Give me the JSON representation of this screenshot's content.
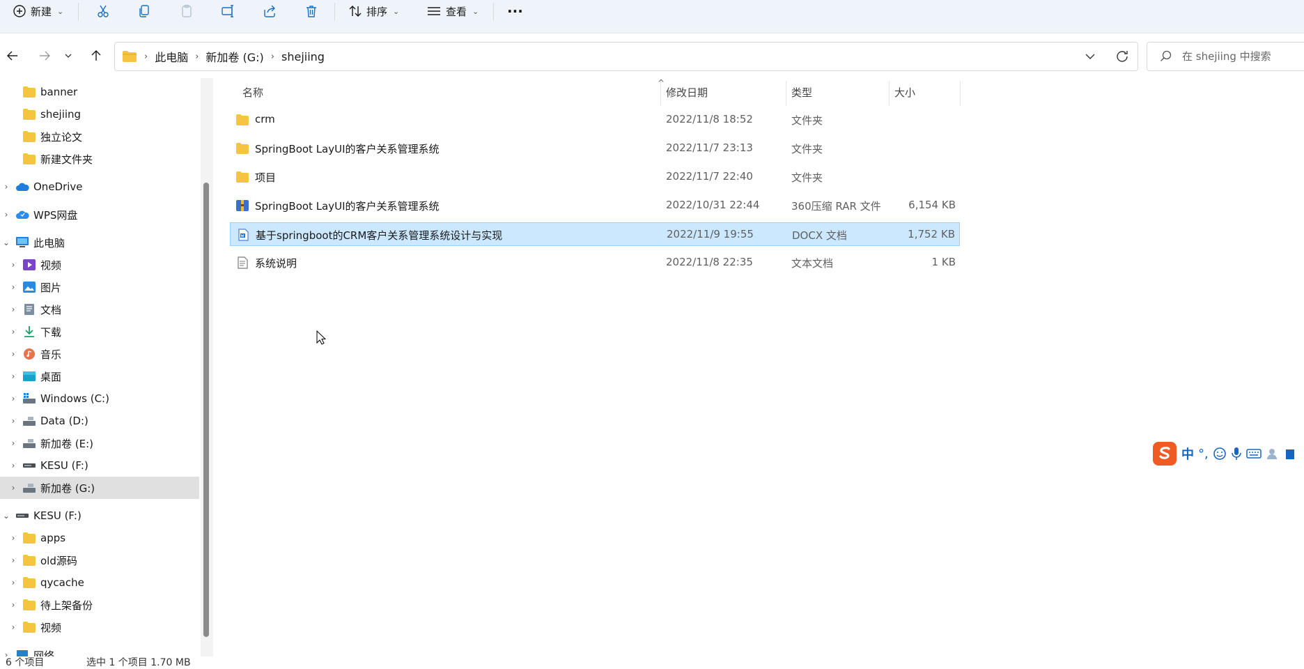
{
  "toolbar": {
    "new_label": "新建",
    "sort_label": "排序",
    "view_label": "查看",
    "more_label": "···"
  },
  "breadcrumb": {
    "items": [
      "此电脑",
      "新加卷 (G:)",
      "shejiing"
    ]
  },
  "search": {
    "placeholder": "在 shejiing 中搜索"
  },
  "sidebar": {
    "items": [
      {
        "label": "banner"
      },
      {
        "label": "shejiing"
      },
      {
        "label": "独立论文"
      },
      {
        "label": "新建文件夹"
      },
      {
        "label": "OneDrive"
      },
      {
        "label": "WPS网盘"
      },
      {
        "label": "此电脑"
      },
      {
        "label": "视频"
      },
      {
        "label": "图片"
      },
      {
        "label": "文档"
      },
      {
        "label": "下载"
      },
      {
        "label": "音乐"
      },
      {
        "label": "桌面"
      },
      {
        "label": "Windows (C:)"
      },
      {
        "label": "Data (D:)"
      },
      {
        "label": "新加卷 (E:)"
      },
      {
        "label": "KESU  (F:)"
      },
      {
        "label": "新加卷 (G:)"
      },
      {
        "label": "KESU  (F:)"
      },
      {
        "label": "apps"
      },
      {
        "label": "old源码"
      },
      {
        "label": "qycache"
      },
      {
        "label": "待上架备份"
      },
      {
        "label": "视频"
      },
      {
        "label": "网络"
      }
    ]
  },
  "columns": {
    "name": "名称",
    "date": "修改日期",
    "type": "类型",
    "size": "大小"
  },
  "files": [
    {
      "name": "crm",
      "date": "2022/11/8 18:52",
      "type": "文件夹",
      "size": "",
      "icon": "folder-icon"
    },
    {
      "name": "SpringBoot LayUI的客户关系管理系统",
      "date": "2022/11/7 23:13",
      "type": "文件夹",
      "size": "",
      "icon": "folder-icon"
    },
    {
      "name": "项目",
      "date": "2022/11/7 22:40",
      "type": "文件夹",
      "size": "",
      "icon": "folder-icon"
    },
    {
      "name": "SpringBoot LayUI的客户关系管理系统",
      "date": "2022/10/31 22:44",
      "type": "360压缩 RAR 文件",
      "size": "6,154 KB",
      "icon": "rar-icon"
    },
    {
      "name": "基于springboot的CRM客户关系管理系统设计与实现",
      "date": "2022/11/9 19:55",
      "type": "DOCX 文档",
      "size": "1,752 KB",
      "icon": "docx-icon"
    },
    {
      "name": "系统说明",
      "date": "2022/11/8 22:35",
      "type": "文本文档",
      "size": "1 KB",
      "icon": "text-file-icon"
    }
  ],
  "ime": {
    "mode": "中",
    "punct": "°,"
  },
  "status": {
    "count": "6 个项目",
    "selected": "选中 1 个项目  1.70 MB"
  },
  "colors": {
    "selection_bg": "#cce8ff",
    "folder": "#f5c542",
    "toolbar_bg": "#eef4f9"
  }
}
